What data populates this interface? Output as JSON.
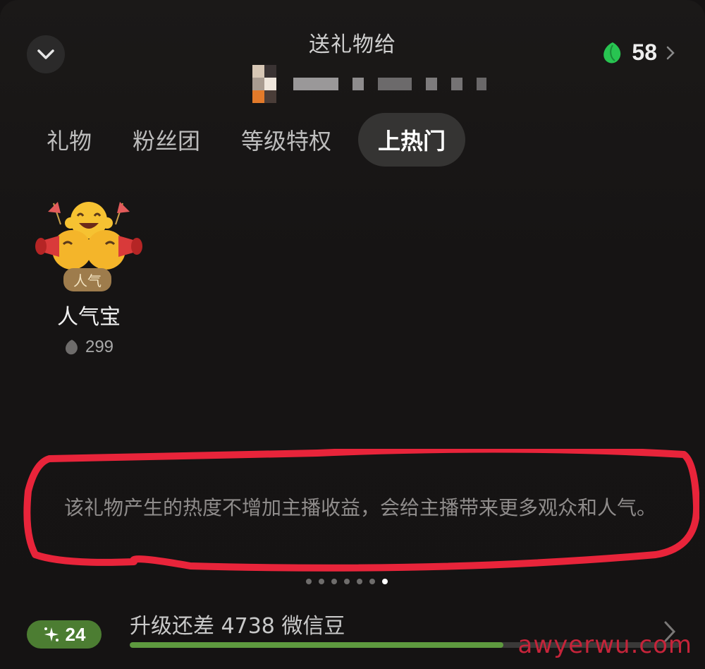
{
  "header": {
    "title": "送礼物给",
    "balance": "58"
  },
  "tabs": [
    {
      "label": "礼物",
      "active": false
    },
    {
      "label": "粉丝团",
      "active": false
    },
    {
      "label": "等级特权",
      "active": false
    },
    {
      "label": "上热门",
      "active": true
    }
  ],
  "gift": {
    "badge": "人气",
    "name": "人气宝",
    "price": "299"
  },
  "description": "该礼物产生的热度不增加主播收益，会给主播带来更多观众和人气。",
  "pager": {
    "total": 7,
    "active_index": 6
  },
  "footer": {
    "level": "24",
    "upgrade_text": "升级还差 4738 微信豆",
    "progress_fraction": 0.68
  },
  "watermark": "awyerwu.com",
  "colors": {
    "accent_green": "#5e9a3f",
    "highlight_red": "#e8243a"
  }
}
